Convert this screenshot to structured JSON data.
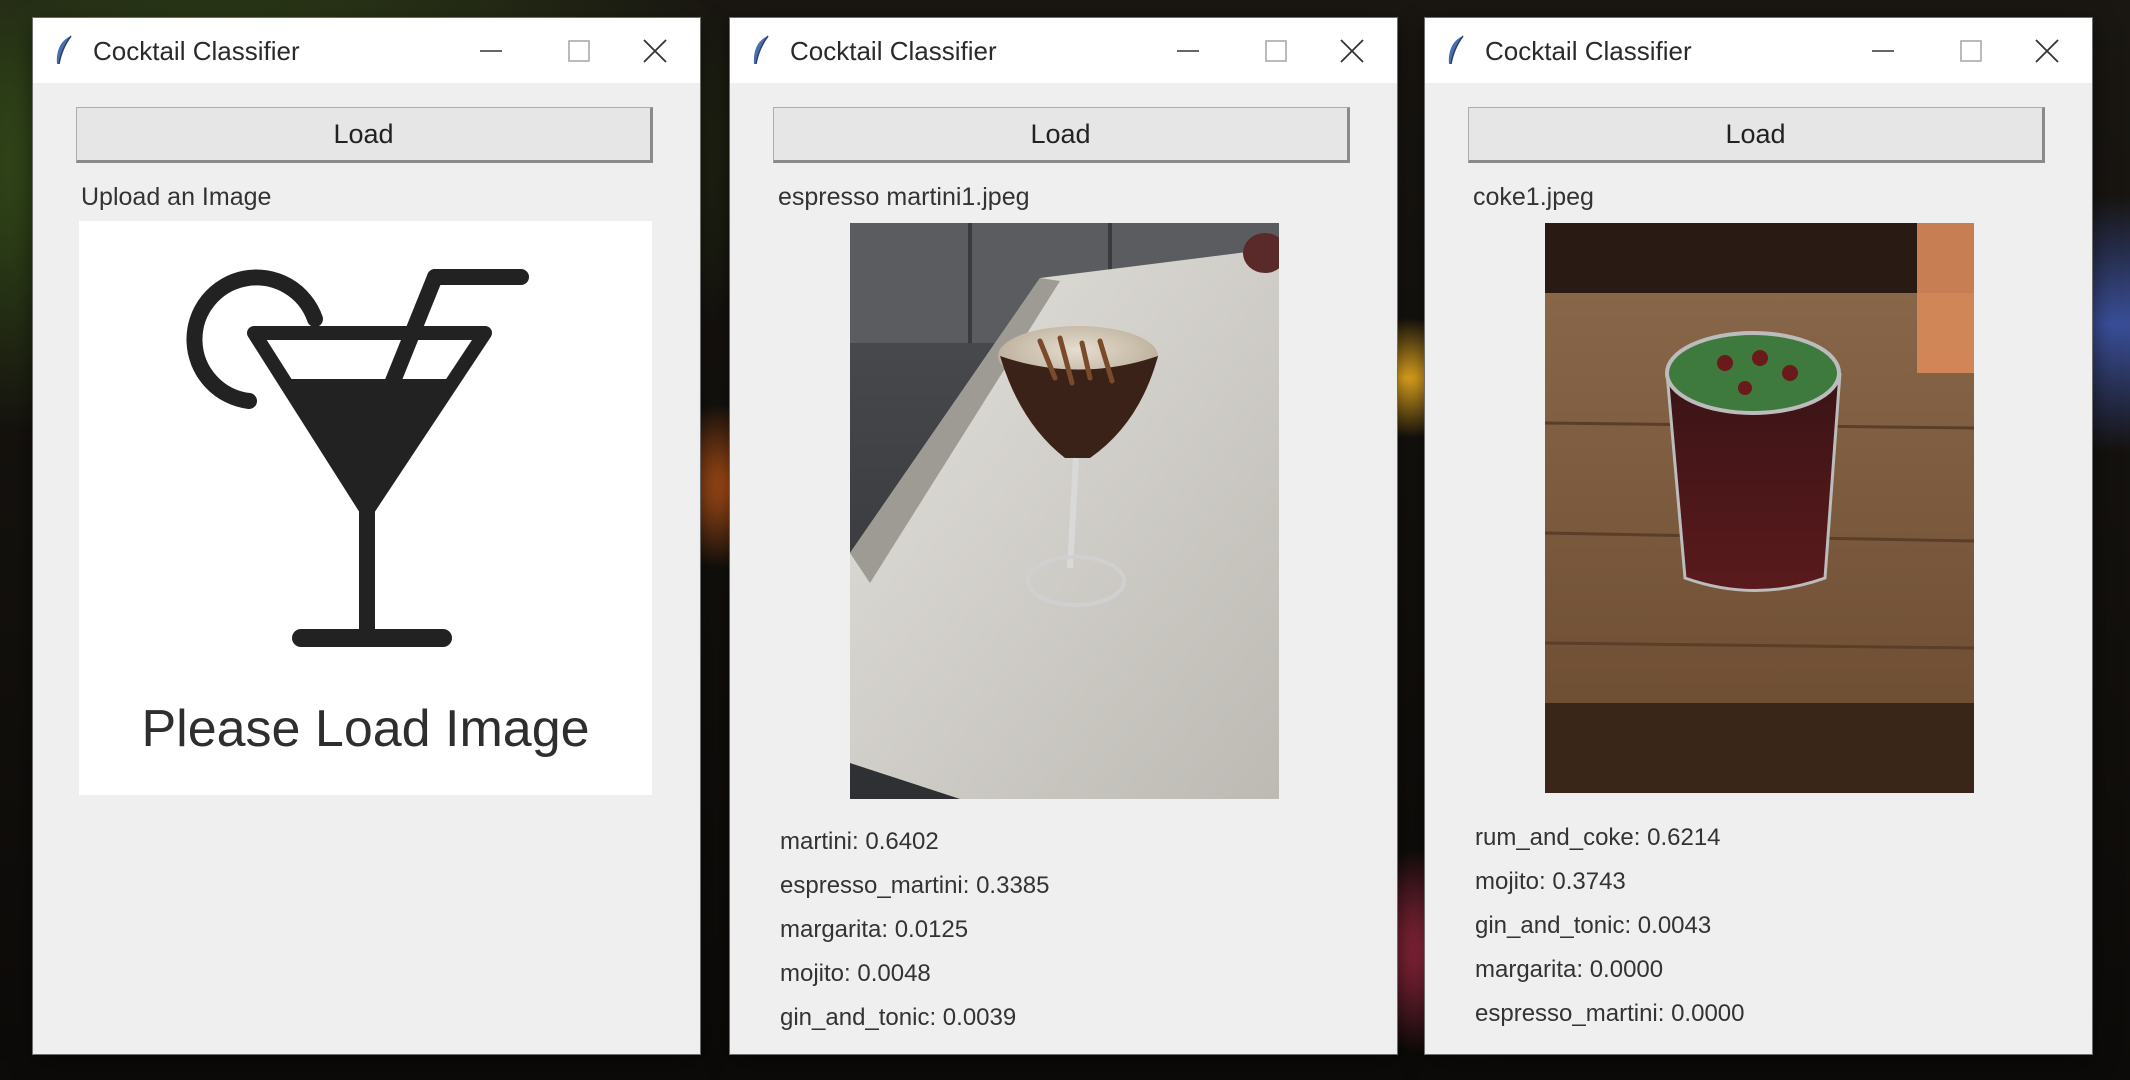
{
  "windows": [
    {
      "title": "Cocktail Classifier",
      "load_label": "Load",
      "file_label": "Upload an Image",
      "placeholder_text": "Please Load Image",
      "results": []
    },
    {
      "title": "Cocktail Classifier",
      "load_label": "Load",
      "file_label": "espresso martini1.jpeg",
      "image": "espresso-martini-photo",
      "results": [
        {
          "label": "martini: 0.6402"
        },
        {
          "label": "espresso_martini: 0.3385"
        },
        {
          "label": "margarita: 0.0125"
        },
        {
          "label": "mojito: 0.0048"
        },
        {
          "label": "gin_and_tonic: 0.0039"
        }
      ]
    },
    {
      "title": "Cocktail Classifier",
      "load_label": "Load",
      "file_label": "coke1.jpeg",
      "image": "rum-and-coke-photo",
      "results": [
        {
          "label": "rum_and_coke: 0.6214"
        },
        {
          "label": "mojito: 0.3743"
        },
        {
          "label": "gin_and_tonic: 0.0043"
        },
        {
          "label": "margarita: 0.0000"
        },
        {
          "label": "espresso_martini: 0.0000"
        }
      ]
    }
  ],
  "icons": {
    "app": "feather-icon",
    "minimize": "minimize-icon",
    "maximize": "maximize-icon",
    "close": "close-icon",
    "placeholder": "cocktail-glass-icon"
  }
}
